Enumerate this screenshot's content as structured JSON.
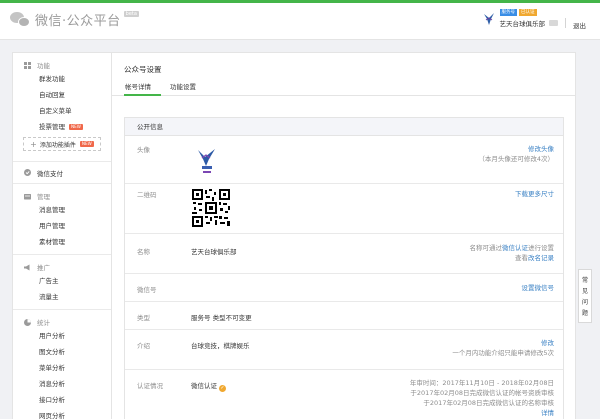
{
  "header": {
    "logo_text": "微信·公众平台",
    "beta": "beta",
    "account": {
      "tag_service": "服务号",
      "tag_verified": "已认证",
      "name": "艺天台球俱乐部",
      "logout": "退出"
    }
  },
  "sidebar": {
    "groups": [
      {
        "title": "功能",
        "items": [
          "群发功能",
          "自动回复",
          "自定义菜单",
          "投票管理"
        ],
        "new_badge": "NEW",
        "add_plugin": "添加功能插件",
        "add_new_badge": "NEW"
      },
      {
        "single": "微信支付"
      },
      {
        "title": "管理",
        "items": [
          "消息管理",
          "用户管理",
          "素材管理"
        ]
      },
      {
        "title": "推广",
        "items": [
          "广告主",
          "流量主"
        ]
      },
      {
        "title": "统计",
        "items": [
          "用户分析",
          "图文分析",
          "菜单分析",
          "消息分析",
          "接口分析",
          "网页分析"
        ]
      }
    ]
  },
  "main": {
    "page_title": "公众号设置",
    "tabs": [
      "帐号详情",
      "功能设置"
    ],
    "panel_title": "公开信息",
    "rows": {
      "avatar": {
        "label": "头像",
        "action": "修改头像",
        "hint": "（本月头像还可修改4次）"
      },
      "qrcode": {
        "label": "二维码",
        "action": "下载更多尺寸"
      },
      "name": {
        "label": "名称",
        "value": "艺天台球俱乐部",
        "hint_prefix": "名称可通过",
        "hint_link": "微信认证",
        "hint_suffix": "进行设置",
        "link2_prefix": "查看",
        "link2": "改名记录"
      },
      "wxid": {
        "label": "微信号",
        "action": "设置微信号"
      },
      "type": {
        "label": "类型",
        "value": "服务号 类型不可变更"
      },
      "intro": {
        "label": "介绍",
        "value": "台球竞技，棋牌娱乐",
        "action": "修改",
        "hint": "一个月内功能介绍只能申请修改5次"
      },
      "auth": {
        "label": "认证情况",
        "value": "微信认证",
        "line1": "年审时间：2017年11月10日 - 2018年02月08日",
        "line2": "于2017年02月08日完成微信认证的帐号资质审核",
        "line3": "于2017年02月08日完成微信认证的名称审核",
        "action": "详情"
      }
    }
  },
  "float_help": [
    "常",
    "见",
    "问",
    "题"
  ],
  "colors": {
    "accent": "#44b549",
    "link": "#3a81c4"
  }
}
